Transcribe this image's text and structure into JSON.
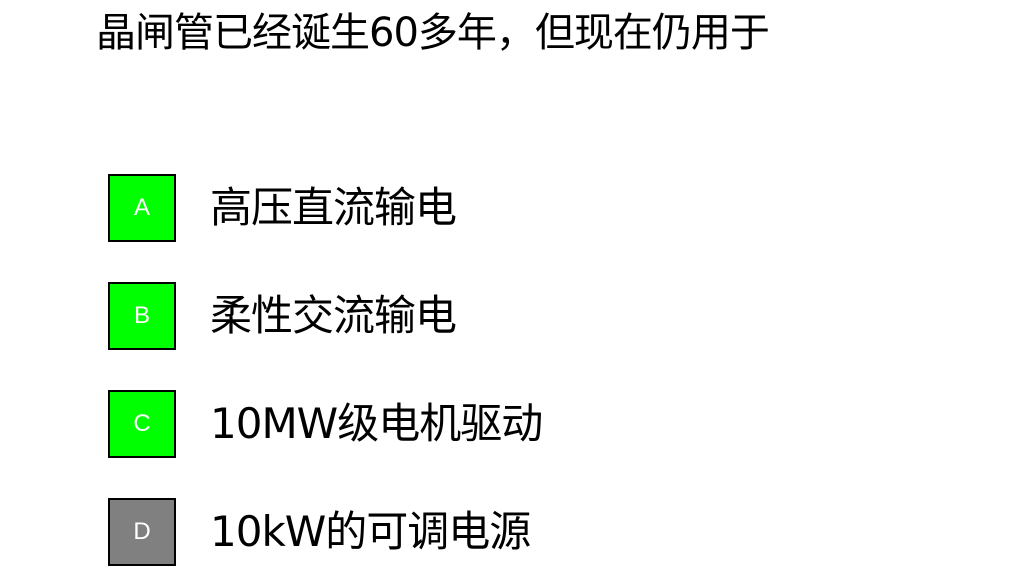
{
  "question": {
    "text": "晶闸管已经诞生60多年，但现在仍用于"
  },
  "options": [
    {
      "letter": "A",
      "text": "高压直流输电",
      "color": "#00ff00"
    },
    {
      "letter": "B",
      "text": "柔性交流输电",
      "color": "#00ff00"
    },
    {
      "letter": "C",
      "text": "10MW级电机驱动",
      "color": "#00ff00"
    },
    {
      "letter": "D",
      "text": "10kW的可调电源",
      "color": "#808080"
    }
  ]
}
